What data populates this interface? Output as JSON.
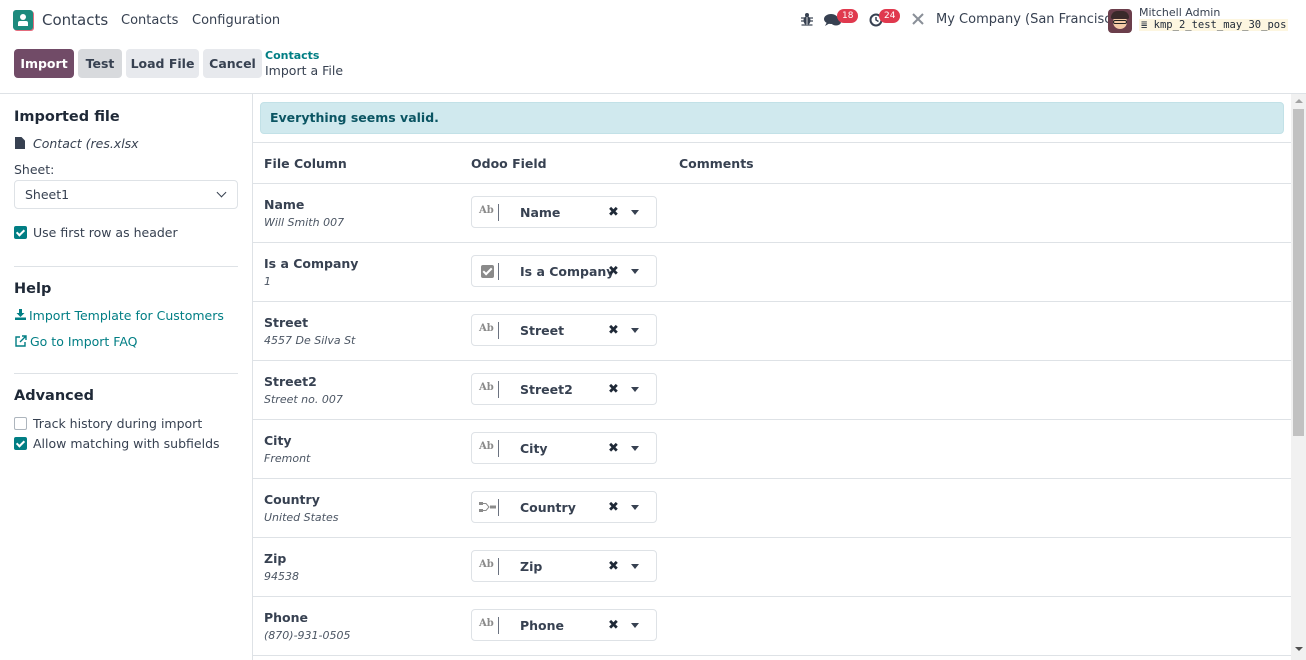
{
  "navbar": {
    "app_name": "Contacts",
    "menu": [
      "Contacts",
      "Configuration"
    ],
    "icons": [
      "bug-icon",
      "chat-icon",
      "activity-clock-icon",
      "tools-icon"
    ],
    "messages_badge": "18",
    "activities_badge": "24",
    "company": "My Company (San Francisco)",
    "user_name": "Mitchell Admin",
    "database": "kmp_2_test_may_30_pos"
  },
  "control_panel": {
    "import_label": "Import",
    "test_label": "Test",
    "load_file_label": "Load File",
    "cancel_label": "Cancel",
    "breadcrumb_parent": "Contacts",
    "breadcrumb_current": "Import a File"
  },
  "sidebar": {
    "imported_file_title": "Imported file",
    "file_name": "Contact (res.xlsx",
    "sheet_label": "Sheet:",
    "sheet_value": "Sheet1",
    "use_first_row_label": "Use first row as header",
    "use_first_row_checked": true,
    "help_title": "Help",
    "help_links": [
      "Import Template for Customers",
      "Go to Import FAQ"
    ],
    "advanced_title": "Advanced",
    "track_history_label": "Track history during import",
    "track_history_checked": false,
    "allow_matching_label": "Allow matching with subfields",
    "allow_matching_checked": true
  },
  "main": {
    "alert": "Everything seems valid.",
    "headers": [
      "File Column",
      "Odoo Field",
      "Comments"
    ],
    "rows": [
      {
        "column": "Name",
        "sample": "Will Smith 007",
        "field": "Name",
        "field_type": "char"
      },
      {
        "column": "Is a Company",
        "sample": "1",
        "field": "Is a Company",
        "field_type": "boolean"
      },
      {
        "column": "Street",
        "sample": "4557 De Silva St",
        "field": "Street",
        "field_type": "char"
      },
      {
        "column": "Street2",
        "sample": "Street no. 007",
        "field": "Street2",
        "field_type": "char"
      },
      {
        "column": "City",
        "sample": "Fremont",
        "field": "City",
        "field_type": "char"
      },
      {
        "column": "Country",
        "sample": "United States",
        "field": "Country",
        "field_type": "many2one"
      },
      {
        "column": "Zip",
        "sample": "94538",
        "field": "Zip",
        "field_type": "char"
      },
      {
        "column": "Phone",
        "sample": "(870)-931-0505",
        "field": "Phone",
        "field_type": "char"
      }
    ],
    "char_type_glyph": "Ab",
    "clear_glyph": "✖"
  }
}
